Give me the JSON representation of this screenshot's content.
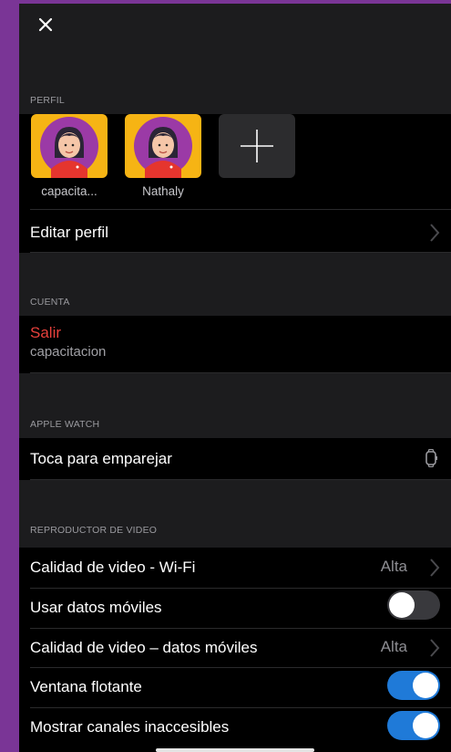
{
  "profile": {
    "section_label": "PERFIL",
    "users": [
      {
        "name": "capacita..."
      },
      {
        "name": "Nathaly"
      }
    ],
    "edit_label": "Editar perfil"
  },
  "account": {
    "section_label": "CUENTA",
    "logout_label": "Salir",
    "username": "capacitacion"
  },
  "apple_watch": {
    "section_label": "APPLE WATCH",
    "pair_label": "Toca para emparejar"
  },
  "video_player": {
    "section_label": "REPRODUCTOR DE VIDEO",
    "wifi_quality_label": "Calidad de video - Wi-Fi",
    "wifi_quality_value": "Alta",
    "mobile_data_label": "Usar datos móviles",
    "mobile_data_on": false,
    "mobile_quality_label": "Calidad de video – datos móviles",
    "mobile_quality_value": "Alta",
    "floating_window_label": "Ventana flotante",
    "floating_window_on": true,
    "inaccessible_channels_label": "Mostrar canales inaccesibles",
    "inaccessible_channels_on": true
  },
  "colors": {
    "background": "#7a3596",
    "accent_toggle": "#1f7ad8",
    "logout_red": "#e8413c",
    "avatar_bg": "#f6b414"
  }
}
